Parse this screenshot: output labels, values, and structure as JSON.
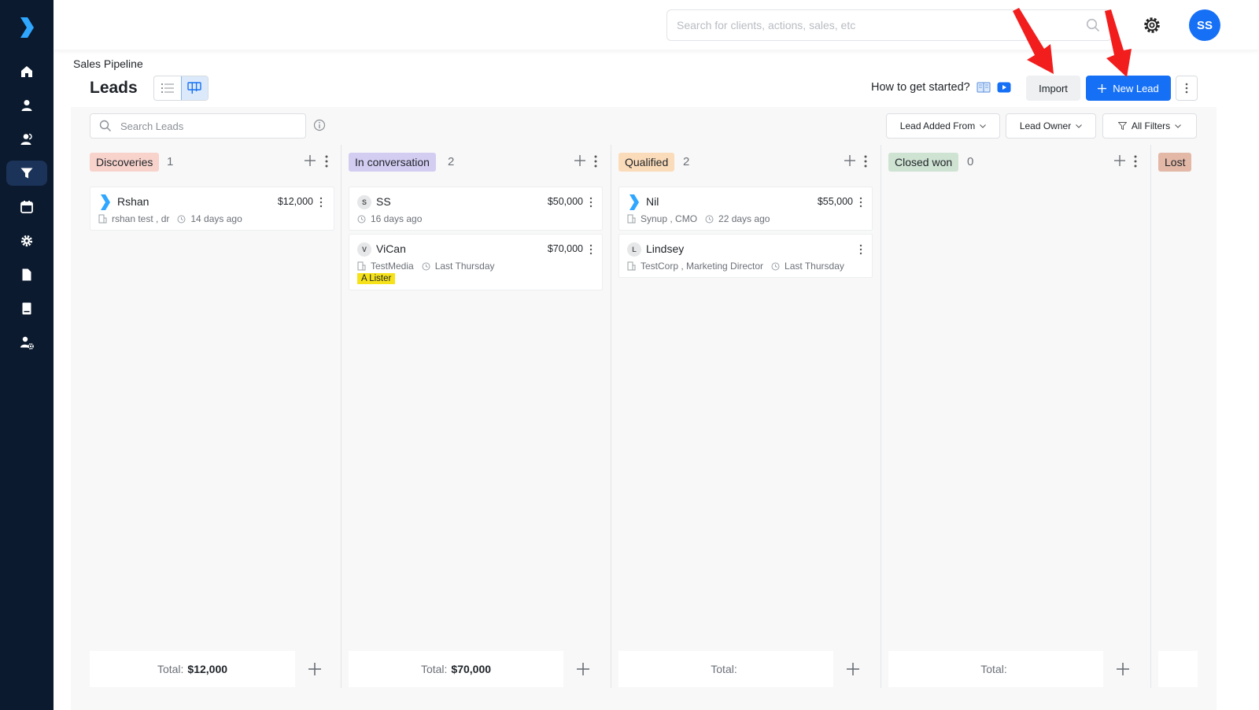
{
  "app": {
    "brand_color": "#1670f5",
    "sidebar_color": "#0b1a2e"
  },
  "sidebar": {
    "items": [
      {
        "name": "home",
        "icon": "home-icon",
        "active": false
      },
      {
        "name": "contacts",
        "icon": "user-icon",
        "active": false
      },
      {
        "name": "clients",
        "icon": "users-icon",
        "active": false
      },
      {
        "name": "sales-pipeline",
        "icon": "funnel-icon",
        "active": true
      },
      {
        "name": "calendar",
        "icon": "calendar-icon",
        "active": false
      },
      {
        "name": "settings",
        "icon": "gear-icon",
        "active": false
      },
      {
        "name": "documents",
        "icon": "document-icon",
        "active": false
      },
      {
        "name": "invoices",
        "icon": "receipt-icon",
        "active": false
      },
      {
        "name": "user-settings",
        "icon": "user-gear-icon",
        "active": false
      }
    ]
  },
  "topbar": {
    "search_placeholder": "Search for clients, actions, sales, etc",
    "avatar_initials": "SS"
  },
  "header": {
    "breadcrumb": "Sales Pipeline",
    "title": "Leads",
    "getting_started": "How to get started?",
    "import_label": "Import",
    "new_lead_label": "New Lead"
  },
  "filters": {
    "search_placeholder": "Search Leads",
    "lead_added_from": "Lead Added From",
    "lead_owner": "Lead Owner",
    "all_filters": "All Filters"
  },
  "columns": [
    {
      "stage": "Discoveries",
      "count": "1",
      "color": "#f8d3cc",
      "total_label": "Total:",
      "total_value": "$12,000",
      "cards": [
        {
          "name": "Rshan",
          "amount": "$12,000",
          "avatar": "",
          "brand_logo": true,
          "company": "rshan test , dr",
          "time": "14 days ago",
          "tag": ""
        }
      ]
    },
    {
      "stage": "In conversation",
      "count": "2",
      "color": "#d3cdf2",
      "total_label": "Total:",
      "total_value": "$70,000",
      "cards": [
        {
          "name": "SS",
          "amount": "$50,000",
          "avatar": "S",
          "brand_logo": false,
          "company": "",
          "time": "16 days ago",
          "tag": ""
        },
        {
          "name": "ViCan",
          "amount": "$70,000",
          "avatar": "V",
          "brand_logo": false,
          "company": "TestMedia",
          "time": "Last Thursday",
          "tag": "A Lister"
        }
      ]
    },
    {
      "stage": "Qualified",
      "count": "2",
      "color": "#fbdcba",
      "total_label": "Total:",
      "total_value": "",
      "cards": [
        {
          "name": "Nil",
          "amount": "$55,000",
          "avatar": "",
          "brand_logo": true,
          "company": "Synup , CMO",
          "time": "22 days ago",
          "tag": ""
        },
        {
          "name": "Lindsey",
          "amount": "",
          "avatar": "L",
          "brand_logo": false,
          "company": "TestCorp , Marketing Director",
          "time": "Last Thursday",
          "tag": ""
        }
      ]
    },
    {
      "stage": "Closed won",
      "count": "0",
      "color": "#cfe3d3",
      "total_label": "Total:",
      "total_value": "",
      "cards": []
    },
    {
      "stage": "Lost",
      "count": "",
      "color": "#e3b8a6",
      "total_label": "",
      "total_value": "",
      "cards": []
    }
  ]
}
